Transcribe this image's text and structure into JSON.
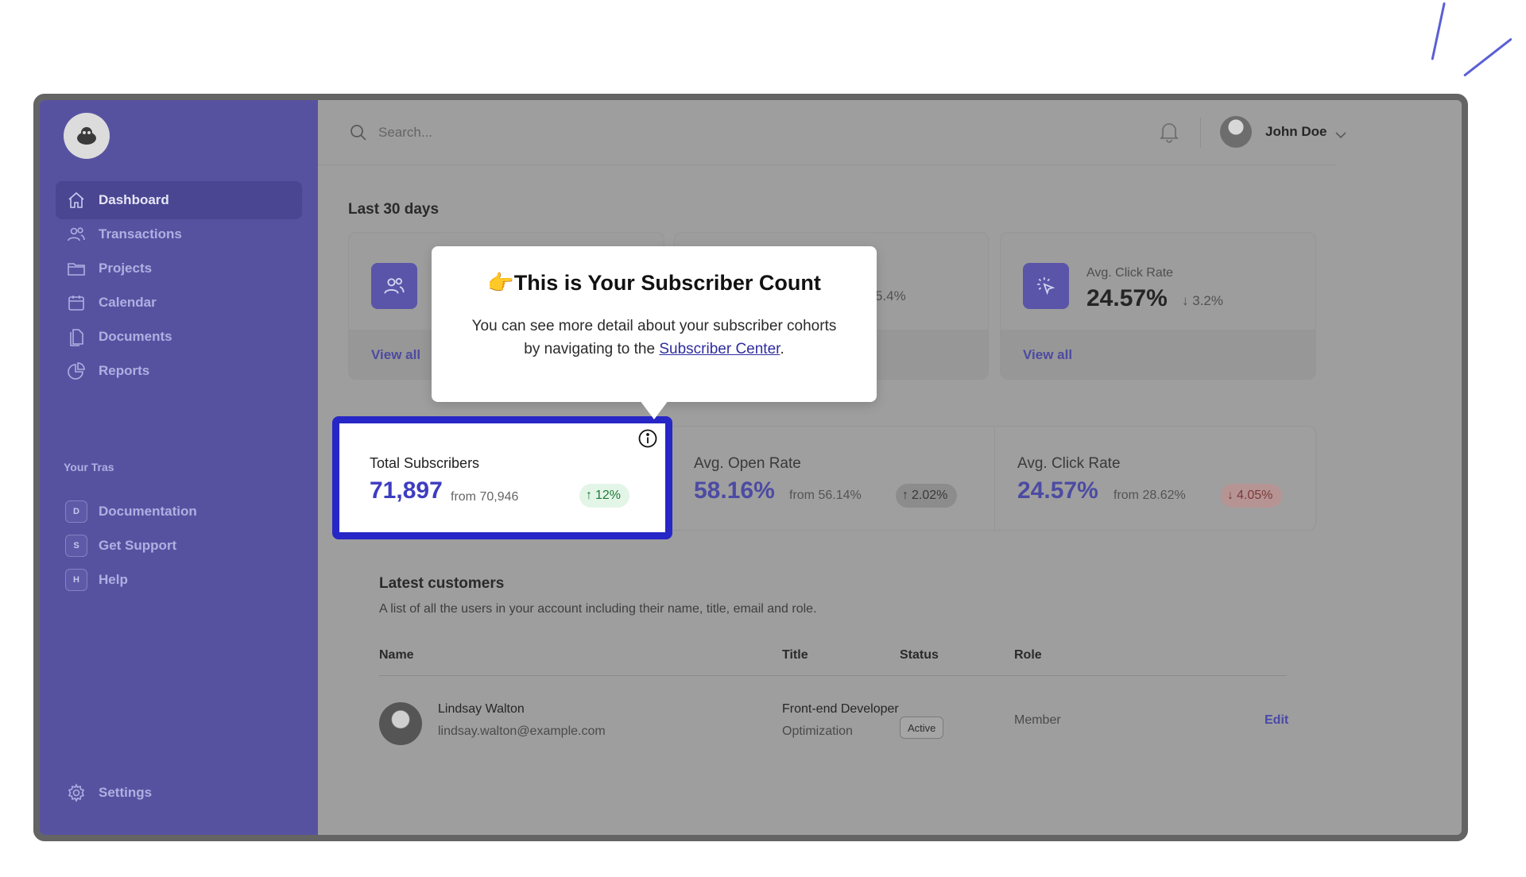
{
  "sidebar": {
    "nav": [
      {
        "label": "Dashboard",
        "icon": "home-icon",
        "active": true
      },
      {
        "label": "Transactions",
        "icon": "users-icon"
      },
      {
        "label": "Projects",
        "icon": "folder-icon"
      },
      {
        "label": "Calendar",
        "icon": "calendar-icon"
      },
      {
        "label": "Documents",
        "icon": "documents-icon"
      },
      {
        "label": "Reports",
        "icon": "pie-chart-icon"
      }
    ],
    "section_label": "Your Tras",
    "teams": [
      {
        "initial": "D",
        "label": "Documentation"
      },
      {
        "initial": "S",
        "label": "Get Support"
      },
      {
        "initial": "H",
        "label": "Help"
      }
    ],
    "settings_label": "Settings"
  },
  "topbar": {
    "search_placeholder": "Search...",
    "user_name": "John Doe"
  },
  "overview": {
    "period_title": "Last 30 days",
    "cards": [
      {
        "icon": "users-icon",
        "link": "View all"
      },
      {
        "value_fragment": "5.4%"
      },
      {
        "icon": "cursor-click-icon",
        "label": "Avg. Click Rate",
        "value": "24.57%",
        "change": "3.2%",
        "link": "View all"
      }
    ]
  },
  "stats": [
    {
      "label": "Total Subscribers",
      "value": "71,897",
      "from": "from 70,946",
      "change": "12%",
      "trend": "up"
    },
    {
      "label": "Avg. Open Rate",
      "value": "58.16%",
      "from": "from 56.14%",
      "change": "2.02%",
      "trend": "up"
    },
    {
      "label": "Avg. Click Rate",
      "value": "24.57%",
      "from": "from 28.62%",
      "change": "4.05%",
      "trend": "down"
    }
  ],
  "tooltip": {
    "emoji": "👉",
    "title": "This is Your Subscriber Count",
    "body_before": "You can see more detail about your subscriber cohorts by navigating to the ",
    "link": "Subscriber Center",
    "body_after": "."
  },
  "customers": {
    "title": "Latest customers",
    "description": "A list of all the users in your account including their name, title, email and role.",
    "columns": [
      "Name",
      "Title",
      "Status",
      "Role"
    ],
    "rows": [
      {
        "name": "Lindsay Walton",
        "email": "lindsay.walton@example.com",
        "title": "Front-end Developer",
        "department": "Optimization",
        "status": "Active",
        "role": "Member",
        "action": "Edit"
      }
    ]
  },
  "colors": {
    "sidebar": "#5752a0",
    "accent": "#2726c6",
    "overlay": "#9e9e9e"
  }
}
